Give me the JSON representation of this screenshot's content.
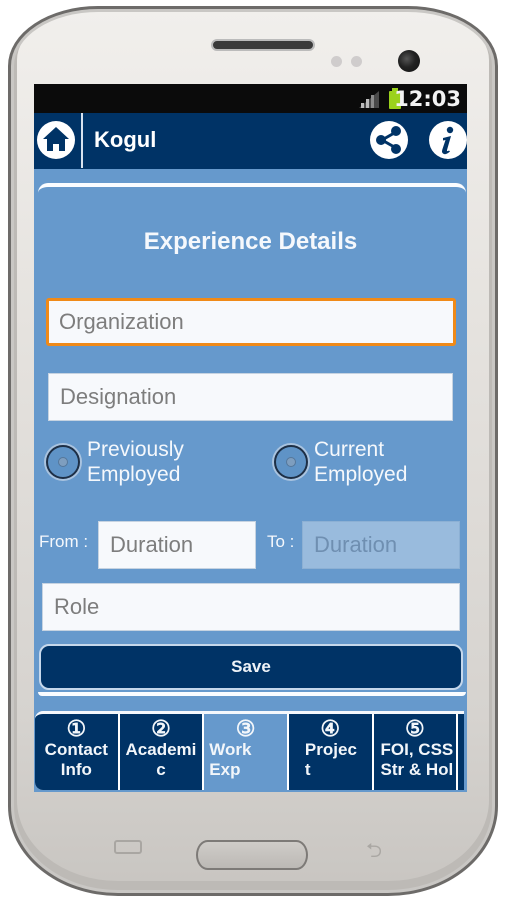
{
  "status_bar": {
    "time": "12:03",
    "signal_icon": "signal-icon",
    "battery_icon": "battery-icon"
  },
  "app_bar": {
    "title": "Kogul",
    "home_icon": "home-icon",
    "share_icon": "share-icon",
    "info_icon": "info-icon"
  },
  "form": {
    "title": "Experience Details",
    "organization": {
      "placeholder": "Organization",
      "value": ""
    },
    "designation": {
      "placeholder": "Designation",
      "value": ""
    },
    "employment_options": [
      {
        "label": "Previously\nEmployed",
        "line1": "Previously",
        "line2": "Employed",
        "selected": false
      },
      {
        "label": "Current\nEmployed",
        "line1": "Current",
        "line2": "Employed",
        "selected": false
      }
    ],
    "from_label": "From :",
    "from": {
      "placeholder": "Duration",
      "value": ""
    },
    "to_label": "To :",
    "to": {
      "placeholder": "Duration",
      "value": "",
      "disabled": true
    },
    "role": {
      "placeholder": "Role",
      "value": ""
    },
    "save_label": "Save"
  },
  "tabs": [
    {
      "number": "①",
      "label": "Contact\nInfo",
      "active": false
    },
    {
      "number": "②",
      "label": "Academi\nc",
      "active": false
    },
    {
      "number": "③",
      "label": "Work\nExp",
      "active": true
    },
    {
      "number": "④",
      "label": "Projec\nt",
      "active": false
    },
    {
      "number": "⑤",
      "label": "FOI, CSS\nStr & Hol",
      "active": false
    }
  ],
  "colors": {
    "primary_dark": "#003366",
    "primary_light": "#6699cc",
    "focus_border": "#f08a18",
    "battery": "#9bd21c"
  }
}
